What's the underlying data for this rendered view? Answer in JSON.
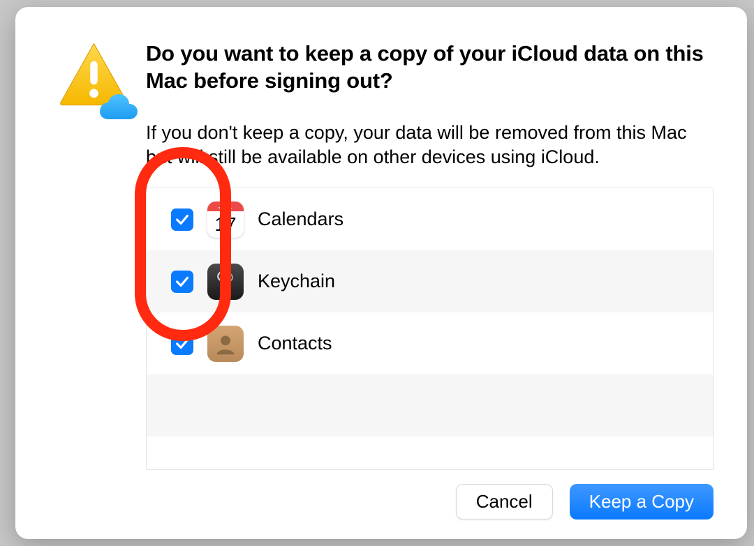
{
  "dialog": {
    "title": "Do you want to keep a copy of your iCloud data on this Mac before signing out?",
    "subtitle": "If you don't keep a copy, your data will be removed from this Mac but will still be available on other devices using iCloud.",
    "items": [
      {
        "label": "Calendars",
        "checked": true,
        "icon": "calendar",
        "cal_month": "JUL",
        "cal_day": "17"
      },
      {
        "label": "Keychain",
        "checked": true,
        "icon": "keychain"
      },
      {
        "label": "Contacts",
        "checked": true,
        "icon": "contacts"
      }
    ],
    "buttons": {
      "cancel": "Cancel",
      "confirm": "Keep a Copy"
    }
  },
  "colors": {
    "accent": "#0a7aff",
    "annotation": "#ff2a0f"
  }
}
